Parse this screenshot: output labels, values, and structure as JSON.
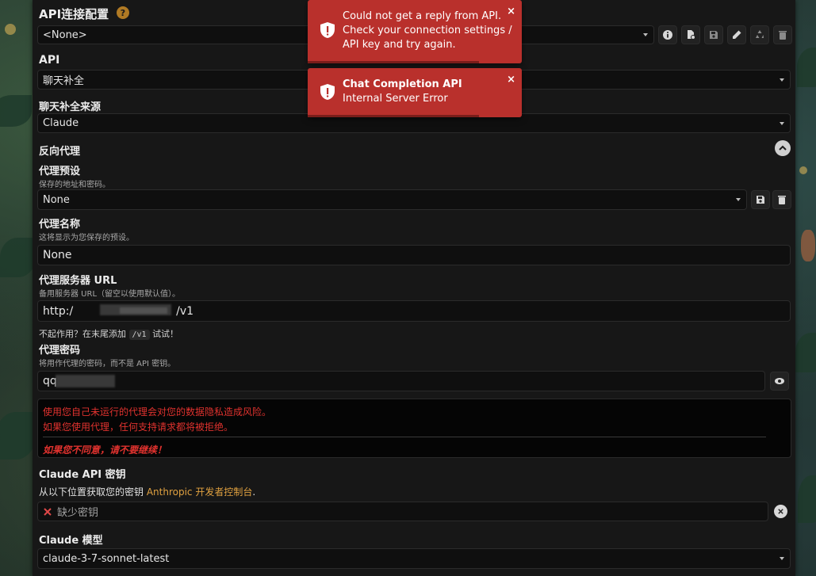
{
  "api_connection": {
    "title": "API连接配置",
    "help_label": "?",
    "selected": "<None>"
  },
  "api": {
    "label": "API",
    "selected": "聊天补全"
  },
  "source": {
    "label": "聊天补全来源",
    "selected": "Claude"
  },
  "reverse_proxy": {
    "label": "反向代理",
    "preset": {
      "label": "代理预设",
      "hint": "保存的地址和密码。",
      "selected": "None"
    },
    "name": {
      "label": "代理名称",
      "hint": "这将显示为您保存的预设。",
      "value": "None"
    },
    "url": {
      "label": "代理服务器 URL",
      "hint": "备用服务器 URL（留空以使用默认值）。",
      "value_start": "http:/",
      "value_end": "/v1",
      "tip_before": "不起作用？在末尾添加",
      "tip_code": "/v1",
      "tip_after": "试试！"
    },
    "password": {
      "label": "代理密码",
      "hint": "将用作代理的密码，而不是 API 密钥。",
      "value_start": "qq"
    },
    "warning": {
      "line1": "使用您自己未运行的代理会对您的数据隐私造成风险。",
      "line2": "如果您使用代理，任何支持请求都将被拒绝。",
      "line3": "如果您不同意，请不要继续！"
    }
  },
  "claude_key": {
    "label": "Claude API 密钥",
    "desc_before": "从以下位置获取您的密钥",
    "desc_link": "Anthropic 开发者控制台",
    "desc_after": ".",
    "missing": "缺少密钥"
  },
  "claude_model": {
    "label": "Claude 模型",
    "selected": "claude-3-7-sonnet-latest"
  },
  "toasts": [
    {
      "line1": "Could not get a reply from API.",
      "line2": "Check your connection settings /",
      "line3": "API key and try again.",
      "close": "×",
      "progress": 0.8
    },
    {
      "title": "Chat Completion API",
      "body": "Internal Server Error",
      "close": "×",
      "progress": 0.8
    }
  ],
  "colors": {
    "toast_bg": "#b9302c",
    "warning_text": "#e0322e",
    "link": "#e0a140",
    "help_bg": "#b07a24"
  }
}
